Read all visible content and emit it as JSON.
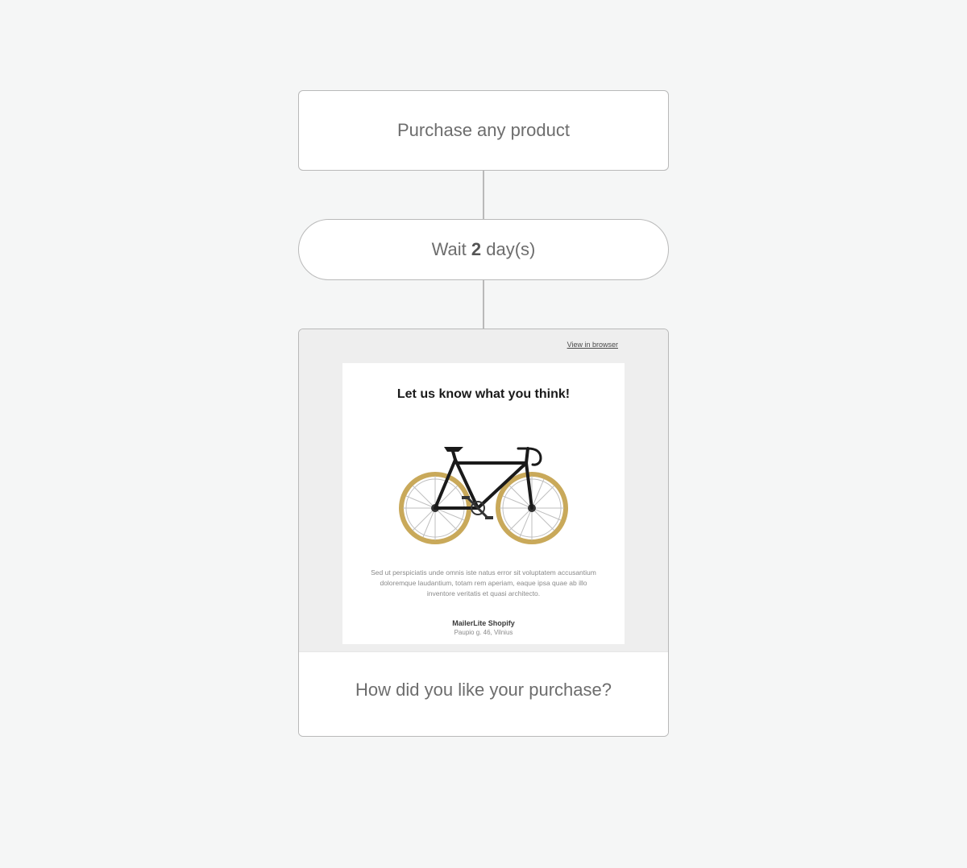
{
  "flow": {
    "trigger": {
      "label": "Purchase any product"
    },
    "wait": {
      "prefix": "Wait ",
      "count": "2",
      "suffix": " day(s)"
    },
    "email": {
      "view_in_browser": "View in browser",
      "heading": "Let us know what you think!",
      "paragraph": "Sed ut perspiciatis unde omnis iste natus error sit voluptatem accusantium doloremque laudantium, totam rem aperiam, eaque ipsa quae ab illo inventore veritatis et quasi architecto.",
      "footer_name": "MailerLite Shopify",
      "footer_address": "Paupio g. 46, Vilnius",
      "caption": "How did you like your purchase?"
    }
  }
}
